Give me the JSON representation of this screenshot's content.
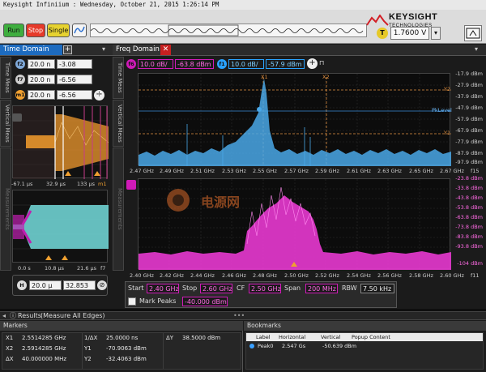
{
  "window": {
    "title": "Keysight Infiniium : Wednesday, October 21, 2015 1:26:14 PM"
  },
  "brand": {
    "name": "KEYSIGHT",
    "sub": "TECHNOLOGIES"
  },
  "toolbar": {
    "run": "Run",
    "stop": "Stop",
    "single": "Single",
    "trigger_badge": "T",
    "trigger_level": "1.7600 V"
  },
  "tabs": {
    "time_domain": "Time Domain",
    "freq_domain": "Freq Domain"
  },
  "side_tabs": {
    "time_meas": "Time Meas",
    "vertical_meas": "Vertical Meas",
    "measurements": "Measurements"
  },
  "time_panel": {
    "rows": [
      {
        "badge": "f2",
        "color": "#7fa8d8",
        "scale": "20.0 n",
        "offset": "-3.08"
      },
      {
        "badge": "f7",
        "color": "#cfcfcf",
        "scale": "20.0 n",
        "offset": "-6.56"
      },
      {
        "badge": "m1",
        "color": "#f0a030",
        "scale": "20.0 n",
        "offset": "-6.56"
      }
    ],
    "top_xaxis": [
      "-67.1 µs",
      "32.9 µs",
      "133 µs",
      "m1"
    ],
    "bottom_xaxis": [
      "0.0 s",
      "10.8 µs",
      "21.6 µs",
      "f7"
    ],
    "hbadge": "H",
    "hscale": "20.0 µ",
    "hpos": "32.853"
  },
  "freq_panel": {
    "top_controls": {
      "f6_badge": "f6",
      "f6_scale": "10.0 dB/",
      "f6_ref": "-63.8 dBm",
      "f1_badge": "f1",
      "f1_scale": "10.0 dB/",
      "f1_ref": "-57.9 dBm"
    },
    "top_y": [
      "-17.9 dBm",
      "-27.9 dBm",
      "-37.9 dBm",
      "-47.9 dBm",
      "-57.9 dBm",
      "-67.9 dBm",
      "-77.9 dBm",
      "-87.9 dBm",
      "-97.9 dBm"
    ],
    "top_x": [
      "2.47 GHz",
      "2.49 GHz",
      "2.51 GHz",
      "2.53 GHz",
      "2.55 GHz",
      "2.57 GHz",
      "2.59 GHz",
      "2.61 GHz",
      "2.63 GHz",
      "2.65 GHz",
      "2.67 GHz",
      "f15"
    ],
    "markers": {
      "x1": "X1",
      "x2": "X2",
      "y1": "Y1",
      "y2": "Y2",
      "pklevel": "PkLevel"
    },
    "bottom_y": [
      "-23.8 dBm",
      "-33.8 dBm",
      "-43.8 dBm",
      "-53.8 dBm",
      "-63.8 dBm",
      "-73.8 dBm",
      "-83.8 dBm",
      "-93.8 dBm",
      "-104 dBm"
    ],
    "bottom_x": [
      "2.40 GHz",
      "2.42 GHz",
      "2.44 GHz",
      "2.46 GHz",
      "2.48 GHz",
      "2.50 GHz",
      "2.52 GHz",
      "2.54 GHz",
      "2.56 GHz",
      "2.58 GHz",
      "2.60 GHz",
      "f11"
    ],
    "watermark": "电源网"
  },
  "span_controls": {
    "start_label": "Start",
    "start": "2.40 GHz",
    "stop_label": "Stop",
    "stop": "2.60 GHz",
    "cf_label": "CF",
    "cf": "2.50 GHz",
    "span_label": "Span",
    "span": "200 MHz",
    "rbw_label": "RBW",
    "rbw": "7.50 kHz",
    "mark_peaks_label": "Mark Peaks",
    "mark_peaks_value": "-40.000 dBm"
  },
  "results": {
    "title": "Results",
    "subtitle": "(Measure All Edges)"
  },
  "markers_panel": {
    "title": "Markers",
    "rows": [
      [
        "X1",
        "2.5514285 GHz",
        "1/ΔX",
        "25.0000 ns",
        "ΔY",
        "38.5000 dBm"
      ],
      [
        "X2",
        "2.5914285 GHz",
        "Y1",
        "-70.9063 dBm",
        "",
        ""
      ],
      [
        "ΔX",
        "40.000000 MHz",
        "Y2",
        "-32.4063 dBm",
        "",
        ""
      ]
    ]
  },
  "bookmarks_panel": {
    "title": "Bookmarks",
    "headers": [
      "Label",
      "Horizontal",
      "Vertical",
      "Popup Content"
    ],
    "rows": [
      [
        "Peak0",
        "2.547 Gs",
        "-50.639 dBm",
        ""
      ]
    ]
  }
}
